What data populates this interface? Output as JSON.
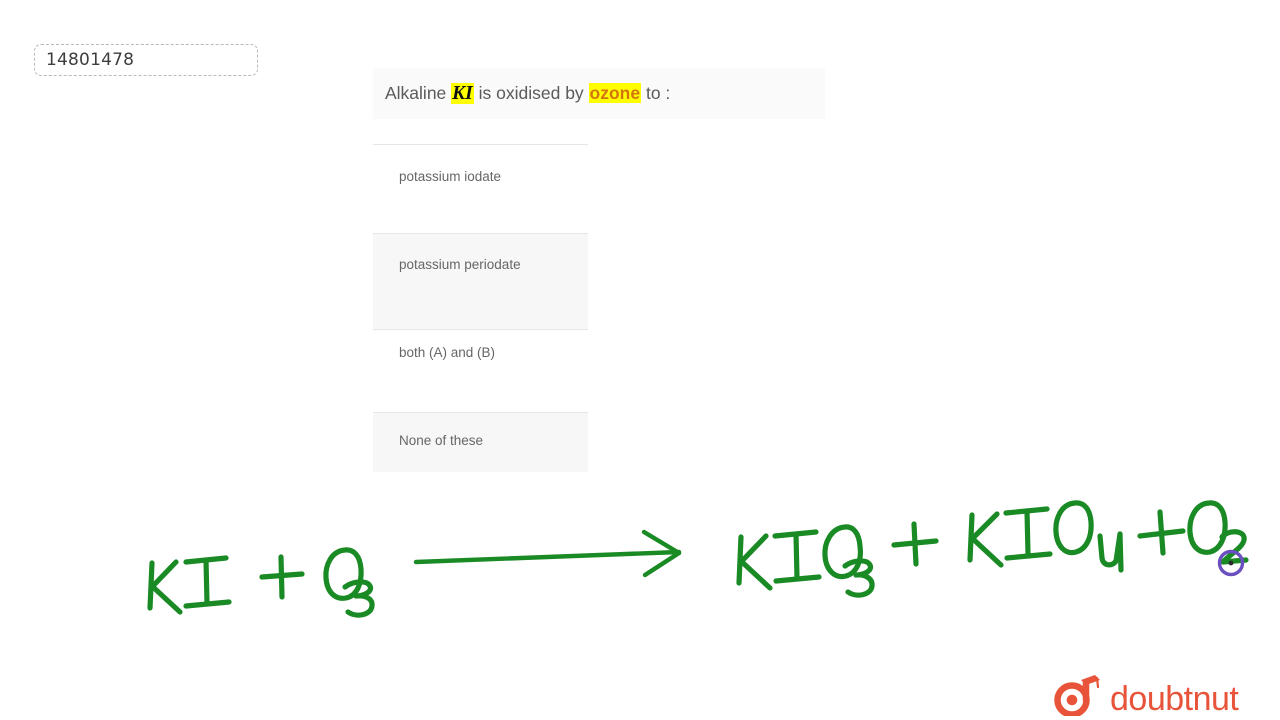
{
  "question_id": {
    "value": "14801478"
  },
  "question": {
    "prefix": "Alkaline ",
    "highlight_formula": "KI",
    "middle": " is oxidised by ",
    "highlight_term": "ozone",
    "suffix": " to :",
    "full_text": "Alkaline KI is oxidised by ozone to :"
  },
  "options": [
    {
      "key": "A",
      "label": "potassium iodate"
    },
    {
      "key": "B",
      "label": "potassium periodate"
    },
    {
      "key": "C",
      "label": "both (A) and (B)"
    },
    {
      "key": "D",
      "label": "None of these"
    }
  ],
  "handwritten_solution": {
    "reactants": "KI + O3",
    "arrow": "right-arrow",
    "products": "KIO3 + KIO4 + O2",
    "ink_color": "#1a8a25",
    "cursor_color": "#6a4fc0",
    "tokens": {
      "ki": "KI",
      "plus1": "+",
      "o3_base": "O",
      "o3_sub": "3",
      "kio3_base": "KIO",
      "kio3_sub": "3",
      "plus2": "+",
      "kio4_base": "KIO",
      "kio4_sub": "4",
      "plus3": "+",
      "o2_base": "O",
      "o2_sub": "2"
    }
  },
  "brand": {
    "name": "doubtnut",
    "color": "#e8543a",
    "icon": "graduation-cap-d-mark"
  },
  "colors": {
    "highlight_yellow": "#ffff00",
    "ozone_orange": "#d4740d",
    "option_gray_bg": "#f7f7f7",
    "question_bg": "#fafafa",
    "text_gray": "#666666"
  }
}
